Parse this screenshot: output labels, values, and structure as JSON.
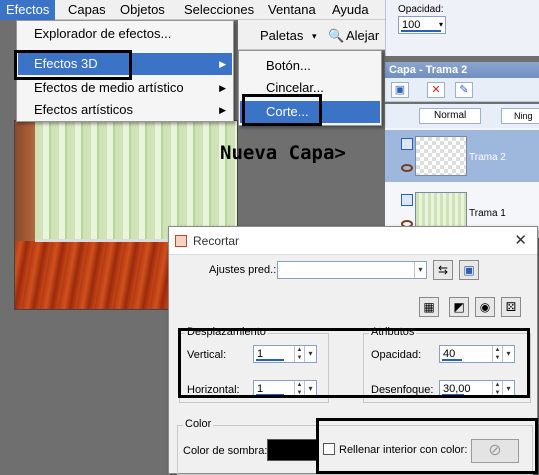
{
  "menubar": {
    "items": [
      {
        "label": "Efectos"
      },
      {
        "label": "Capas"
      },
      {
        "label": "Objetos"
      },
      {
        "label": "Selecciones"
      },
      {
        "label": "Ventana"
      },
      {
        "label": "Ayuda"
      }
    ]
  },
  "toolbar2": {
    "palettes_label": "Paletas",
    "palettes_arrow": "▾",
    "align_label": "Alejar"
  },
  "dropdown1": {
    "items": [
      {
        "label": "Explorador de efectos..."
      },
      {
        "label": "Efectos 3D",
        "arrow": "▶"
      },
      {
        "label": "Efectos de medio artístico",
        "arrow": "▶"
      },
      {
        "label": "Efectos artísticos",
        "arrow": "▶"
      }
    ]
  },
  "dropdown2": {
    "items": [
      {
        "label": "Botón..."
      },
      {
        "label": "Cincelar..."
      },
      {
        "label": "Corte..."
      }
    ]
  },
  "opacity_panel": {
    "label": "Opacidad:",
    "value": "100",
    "arrow": "▾"
  },
  "layers": {
    "title": "Capa - Trama 2",
    "blend_mode": "Normal",
    "lock_label": "Ning",
    "rows": [
      {
        "name": "Trama 2",
        "selected": true
      },
      {
        "name": "Trama 1",
        "selected": false
      }
    ]
  },
  "annotation": {
    "text": "Nueva Capa>"
  },
  "dialog": {
    "title": "Recortar",
    "close": "✕",
    "preset_label": "Ajustes pred.:",
    "preset_value": "",
    "preset_arrow": "▾",
    "offset_group": "Desplazamiento",
    "vertical_label": "Vertical:",
    "vertical_value": "1",
    "horizontal_label": "Horizontal:",
    "horizontal_value": "1",
    "attrs_group": "Atributos",
    "opacity_label": "Opacidad:",
    "opacity_value": "40",
    "blur_label": "Desenfoque:",
    "blur_value": "30,00",
    "color_group": "Color",
    "shadow_label": "Color de sombra:",
    "shadow_color": "#000000",
    "fill_label": "Rellenar interior con color:"
  },
  "colors": {
    "menu_highlight": "#3b73c7",
    "layer_selected": "#9db7dd",
    "slider_accent": "#2b5fb8"
  }
}
